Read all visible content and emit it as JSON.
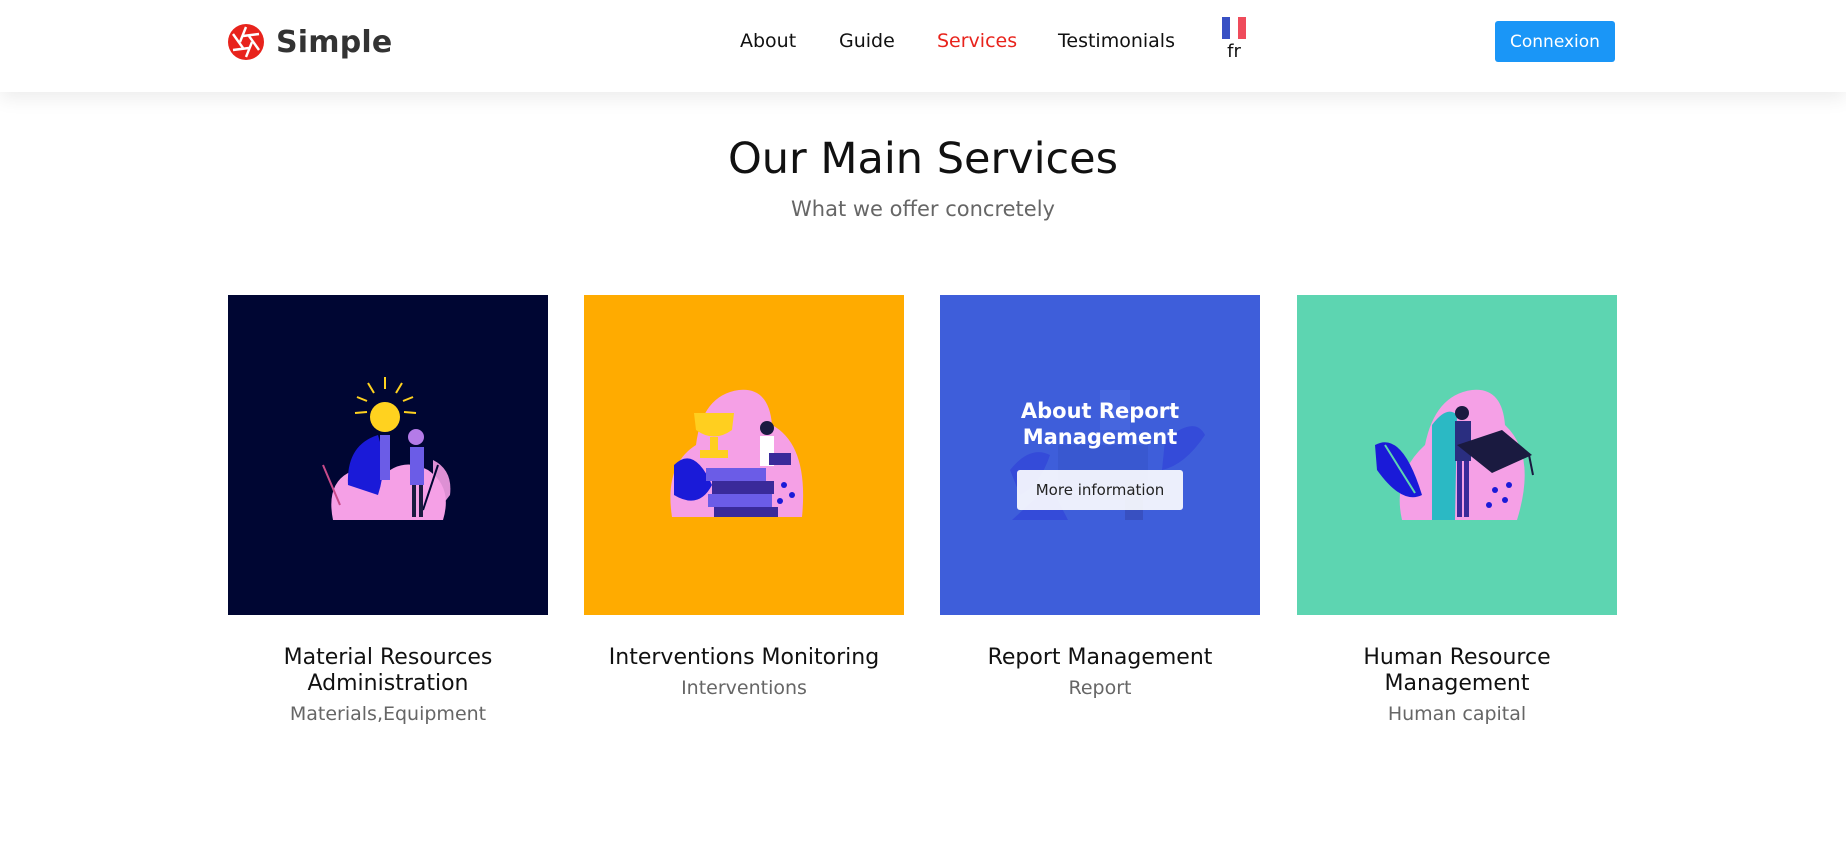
{
  "header": {
    "brand": "Simple",
    "brand_color": "#e8231c",
    "nav": [
      {
        "label": "About",
        "active": false
      },
      {
        "label": "Guide",
        "active": false
      },
      {
        "label": "Services",
        "active": true
      },
      {
        "label": "Testimonials",
        "active": false
      }
    ],
    "language": {
      "code": "fr",
      "flag_icon": "france-flag-icon"
    },
    "login_label": "Connexion",
    "login_color": "#1a96f7"
  },
  "main": {
    "title": "Our Main Services",
    "subtitle": "What we offer concretely",
    "services": [
      {
        "title": "Material Resources Administration",
        "subtitle": "Materials,Equipment",
        "bg_color": "#000633",
        "illustration": "idea-lightbulb-illustration"
      },
      {
        "title": "Interventions Monitoring",
        "subtitle": "Interventions",
        "bg_color": "#ffab00",
        "illustration": "trophy-books-illustration"
      },
      {
        "title": "Report Management",
        "subtitle": "Report",
        "bg_color": "#3f5eda",
        "illustration": "report-desk-illustration",
        "overlay": {
          "title": "About Report Management",
          "button_label": "More information"
        }
      },
      {
        "title": "Human Resource Management",
        "subtitle": "Human capital",
        "bg_color": "#5dd5b1",
        "illustration": "graduation-cap-illustration"
      }
    ]
  }
}
